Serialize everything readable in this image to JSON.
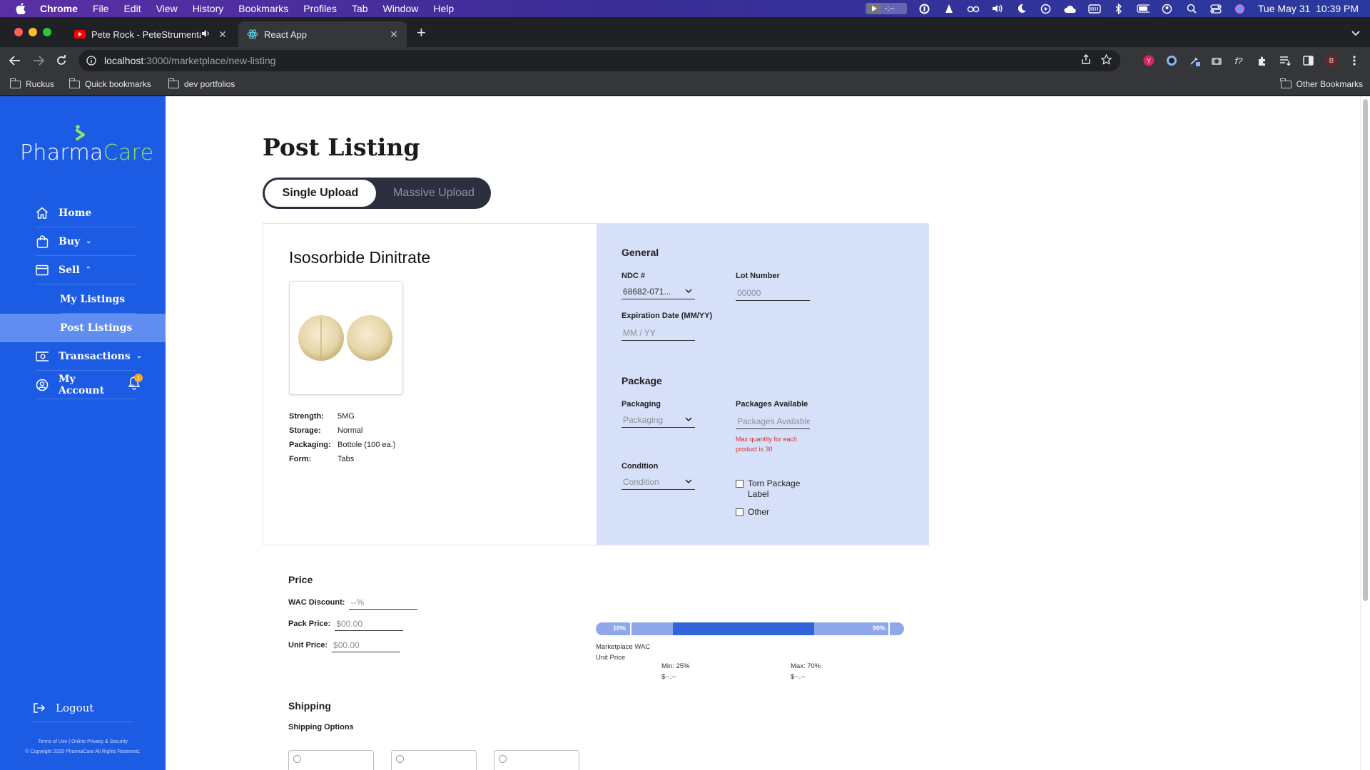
{
  "menubar": {
    "app": "Chrome",
    "items": [
      "File",
      "Edit",
      "View",
      "History",
      "Bookmarks",
      "Profiles",
      "Tab",
      "Window",
      "Help"
    ],
    "media_time": "-:--",
    "datetime": "Tue May 31  10:39 PM"
  },
  "browser": {
    "tabs": [
      {
        "title": "Pete Rock - PeteStrumenta",
        "favicon": "youtube-icon",
        "active": false
      },
      {
        "title": "React App",
        "favicon": "react-icon",
        "active": true
      }
    ],
    "url_host": "localhost",
    "url_path": ":3000/marketplace/new-listing",
    "bookmarks": [
      "Ruckus",
      "Quick bookmarks",
      "dev portfolios"
    ],
    "other_bookmarks": "Other Bookmarks",
    "profile_initial": "B"
  },
  "sidebar": {
    "logo_part1": "Pharma",
    "logo_part2": "Care",
    "items": [
      {
        "label": "Home",
        "icon": "home-icon"
      },
      {
        "label": "Buy",
        "icon": "shopping-bag-icon"
      },
      {
        "label": "Sell",
        "icon": "storefront-icon"
      },
      {
        "label": "My Listings"
      },
      {
        "label": "Post Listings"
      },
      {
        "label": "Transactions",
        "icon": "cash-icon"
      },
      {
        "label": "My Account",
        "icon": "user-circle-icon"
      }
    ],
    "notification_count": "1",
    "logout": "Logout",
    "terms": "Terms of Use | Online Privacy & Security",
    "copyright": "© Copyright 2020 PharmaCare All Rights Reserved."
  },
  "main": {
    "title": "Post Listing",
    "upload_tabs": {
      "single": "Single Upload",
      "massive": "Massive Upload"
    },
    "product": {
      "name": "Isosorbide Dinitrate",
      "specs": [
        {
          "k": "Strength:",
          "v": "5MG"
        },
        {
          "k": "Storage:",
          "v": "Normal"
        },
        {
          "k": "Packaging:",
          "v": "Bottole (100 ea.)"
        },
        {
          "k": "Form:",
          "v": "Tabs"
        }
      ]
    },
    "general": {
      "heading": "General",
      "ndc_label": "NDC #",
      "ndc_value": "68682-071...",
      "lot_label": "Lot Number",
      "lot_placeholder": "00000",
      "exp_label": "Expiration Date (MM/YY)",
      "exp_placeholder": "MM / YY"
    },
    "package": {
      "heading": "Package",
      "packaging_label": "Packaging",
      "packaging_placeholder": "Packaging",
      "avail_label": "Packages Available",
      "avail_placeholder": "Packages Available",
      "avail_error_1": "Max quantity for each",
      "avail_error_2": "product is 30",
      "condition_label": "Condition",
      "condition_placeholder": "Condition",
      "check_torn_1": "Torn Package",
      "check_torn_2": "Label",
      "check_other": "Other"
    },
    "price": {
      "heading": "Price",
      "wac_label": "WAC Discount:",
      "wac_placeholder": "--%",
      "pack_label": "Pack Price:",
      "pack_placeholder": "$00.00",
      "unit_label": "Unit Price:",
      "unit_placeholder": "$00.00",
      "range_low": "10%",
      "range_high": "90%",
      "range_min_fraction": 0.25,
      "range_max_fraction": 0.7,
      "mwac_line1": "Marketplace WAC",
      "mwac_line2": "Unit Price",
      "min_label": "Min: 25%",
      "min_value": "$--.--",
      "max_label": "Max: 70%",
      "max_value": "$--.--"
    },
    "shipping": {
      "heading": "Shipping",
      "options_label": "Shipping Options"
    }
  }
}
